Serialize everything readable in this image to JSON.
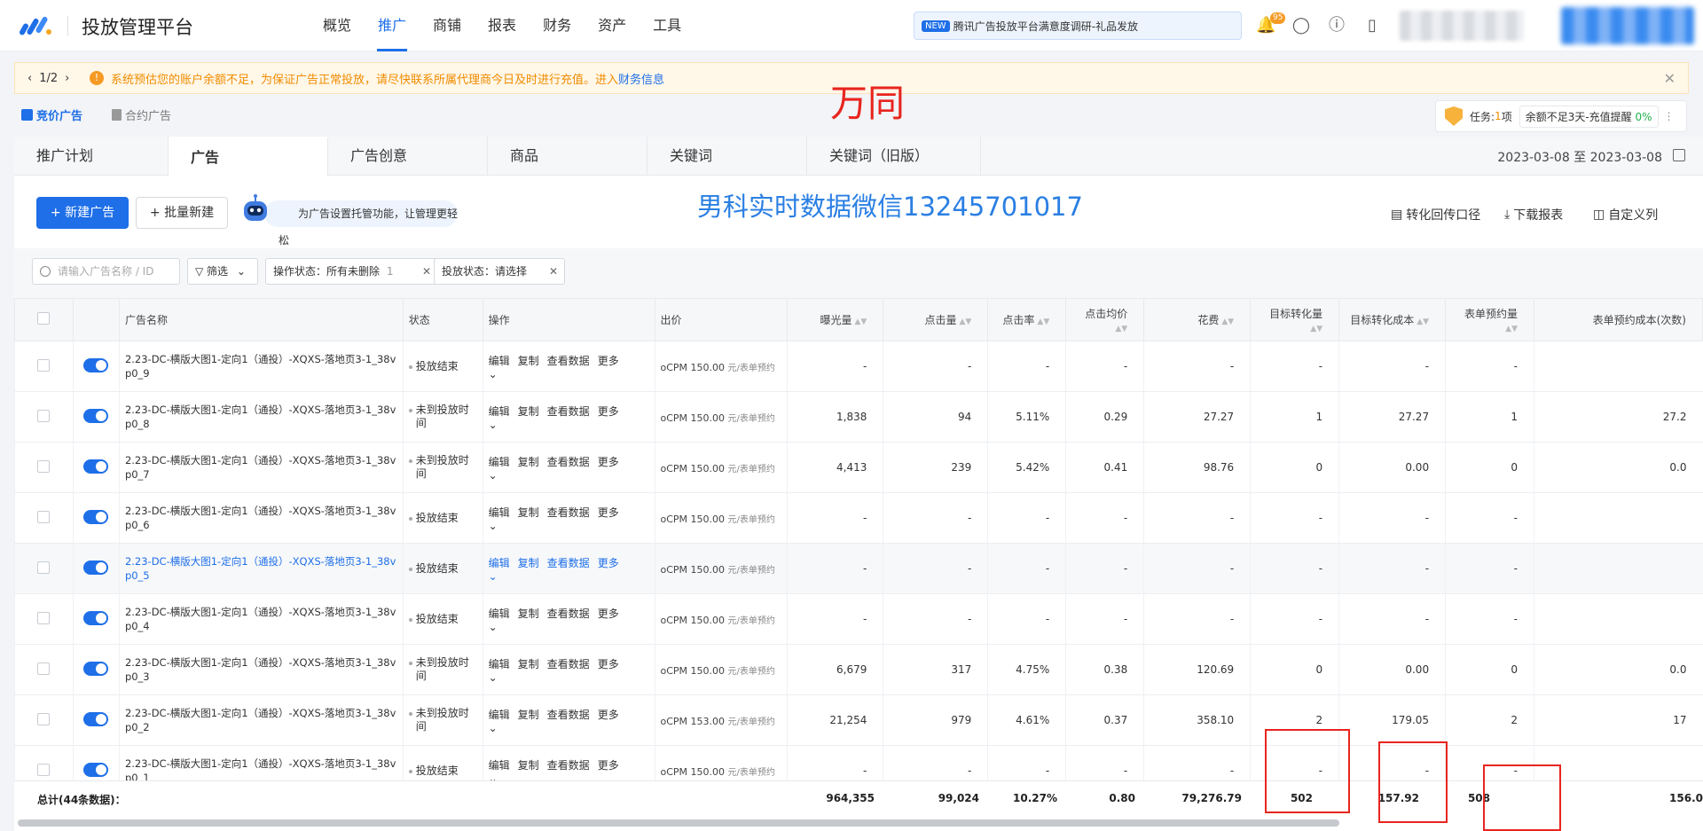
{
  "app": {
    "title": "投放管理平台"
  },
  "nav": [
    "概览",
    "推广",
    "商铺",
    "报表",
    "财务",
    "资产",
    "工具"
  ],
  "nav_active": "推广",
  "notice": {
    "tag": "NEW",
    "text": "腾讯广告投放平台满意度调研-礼品发放"
  },
  "bell_badge": "95",
  "alert": {
    "pager": "1/2",
    "text": "系统预估您的账户余额不足，为保证广告正常投放，请尽快联系所属代理商今日及时进行充值。进入",
    "link": "财务信息"
  },
  "subtabs": {
    "active": "竞价广告",
    "inactive": "合约广告"
  },
  "watermark1": "万同",
  "watermark2": "男科实时数据微信13245701017",
  "task": {
    "label": "任务:",
    "count": "1",
    "unit": "项",
    "btn": "余额不足3天-充值提醒",
    "pct": "0%"
  },
  "tabs": [
    "推广计划",
    "广告",
    "广告创意",
    "商品",
    "关键词",
    "关键词（旧版）"
  ],
  "tab_active": "广告",
  "date_range": "2023-03-08 至 2023-03-08",
  "toolbar": {
    "new_ad": "新建广告",
    "batch_new": "批量新建",
    "robot_tip": "为广告设置托管功能，让管理更轻松",
    "conv_path": "转化回传口径",
    "download": "下载报表",
    "custom_cols": "自定义列"
  },
  "filters": {
    "search_placeholder": "请输入广告名称 / ID",
    "filter_label": "筛选",
    "op_status": "操作状态：所有未删除",
    "op_status_count": "1",
    "delivery_status": "投放状态：请选择"
  },
  "columns": [
    "广告名称",
    "状态",
    "操作",
    "出价",
    "曝光量",
    "点击量",
    "点击率",
    "点击均价",
    "花费",
    "目标转化量",
    "目标转化成本",
    "表单预约量",
    "表单预约成本(次数)"
  ],
  "row_ops": [
    "编辑",
    "复制",
    "查看数据",
    "更多"
  ],
  "rows": [
    {
      "name1": "2.23-DC-横版大图1-定向1（通投）-XQXS-落地页3-1_38v",
      "name2": "p0_9",
      "status1": "投放结束",
      "status2": "",
      "bid": "oCPM  150.00",
      "bid_unit": "元/表单预约",
      "imp": "-",
      "clk": "-",
      "ctr": "-",
      "cpc": "-",
      "cost": "-",
      "conv": "-",
      "cpa": "-",
      "form": "-",
      "form_cost": ""
    },
    {
      "name1": "2.23-DC-横版大图1-定向1（通投）-XQXS-落地页3-1_38v",
      "name2": "p0_8",
      "status1": "未到投放时",
      "status2": "间",
      "bid": "oCPM  150.00",
      "bid_unit": "元/表单预约",
      "imp": "1,838",
      "clk": "94",
      "ctr": "5.11%",
      "cpc": "0.29",
      "cost": "27.27",
      "conv": "1",
      "cpa": "27.27",
      "form": "1",
      "form_cost": "27.2"
    },
    {
      "name1": "2.23-DC-横版大图1-定向1（通投）-XQXS-落地页3-1_38v",
      "name2": "p0_7",
      "status1": "未到投放时",
      "status2": "间",
      "bid": "oCPM  150.00",
      "bid_unit": "元/表单预约",
      "imp": "4,413",
      "clk": "239",
      "ctr": "5.42%",
      "cpc": "0.41",
      "cost": "98.76",
      "conv": "0",
      "cpa": "0.00",
      "form": "0",
      "form_cost": "0.0"
    },
    {
      "name1": "2.23-DC-横版大图1-定向1（通投）-XQXS-落地页3-1_38v",
      "name2": "p0_6",
      "status1": "投放结束",
      "status2": "",
      "bid": "oCPM  150.00",
      "bid_unit": "元/表单预约",
      "imp": "-",
      "clk": "-",
      "ctr": "-",
      "cpc": "-",
      "cost": "-",
      "conv": "-",
      "cpa": "-",
      "form": "-",
      "form_cost": ""
    },
    {
      "name1": "2.23-DC-横版大图1-定向1（通投）-XQXS-落地页3-1_38v",
      "name2": "p0_5",
      "status1": "投放结束",
      "status2": "",
      "bid": "oCPM  150.00",
      "bid_unit": "元/表单预约",
      "imp": "-",
      "clk": "-",
      "ctr": "-",
      "cpc": "-",
      "cost": "-",
      "conv": "-",
      "cpa": "-",
      "form": "-",
      "form_cost": "",
      "hl": true
    },
    {
      "name1": "2.23-DC-横版大图1-定向1（通投）-XQXS-落地页3-1_38v",
      "name2": "p0_4",
      "status1": "投放结束",
      "status2": "",
      "bid": "oCPM  150.00",
      "bid_unit": "元/表单预约",
      "imp": "-",
      "clk": "-",
      "ctr": "-",
      "cpc": "-",
      "cost": "-",
      "conv": "-",
      "cpa": "-",
      "form": "-",
      "form_cost": ""
    },
    {
      "name1": "2.23-DC-横版大图1-定向1（通投）-XQXS-落地页3-1_38v",
      "name2": "p0_3",
      "status1": "未到投放时",
      "status2": "间",
      "bid": "oCPM  150.00",
      "bid_unit": "元/表单预约",
      "imp": "6,679",
      "clk": "317",
      "ctr": "4.75%",
      "cpc": "0.38",
      "cost": "120.69",
      "conv": "0",
      "cpa": "0.00",
      "form": "0",
      "form_cost": "0.0"
    },
    {
      "name1": "2.23-DC-横版大图1-定向1（通投）-XQXS-落地页3-1_38v",
      "name2": "p0_2",
      "status1": "未到投放时",
      "status2": "间",
      "bid": "oCPM  153.00",
      "bid_unit": "元/表单预约",
      "imp": "21,254",
      "clk": "979",
      "ctr": "4.61%",
      "cpc": "0.37",
      "cost": "358.10",
      "conv": "2",
      "cpa": "179.05",
      "form": "2",
      "form_cost": "17"
    },
    {
      "name1": "2.23-DC-横版大图1-定向1（通投）-XQXS-落地页3-1_38v",
      "name2": "p0_1",
      "status1": "投放结束",
      "status2": "",
      "bid": "oCPM  150.00",
      "bid_unit": "元/表单预约",
      "imp": "-",
      "clk": "-",
      "ctr": "-",
      "cpc": "-",
      "cost": "-",
      "conv": "-",
      "cpa": "-",
      "form": "-",
      "form_cost": ""
    }
  ],
  "totals": {
    "label": "总计(44条数据)：",
    "imp": "964,355",
    "clk": "99,024",
    "ctr": "10.27%",
    "cpc": "0.80",
    "cost": "79,276.79",
    "conv": "502",
    "cpa": "157.92",
    "form": "508",
    "form_cost": "156.0"
  }
}
